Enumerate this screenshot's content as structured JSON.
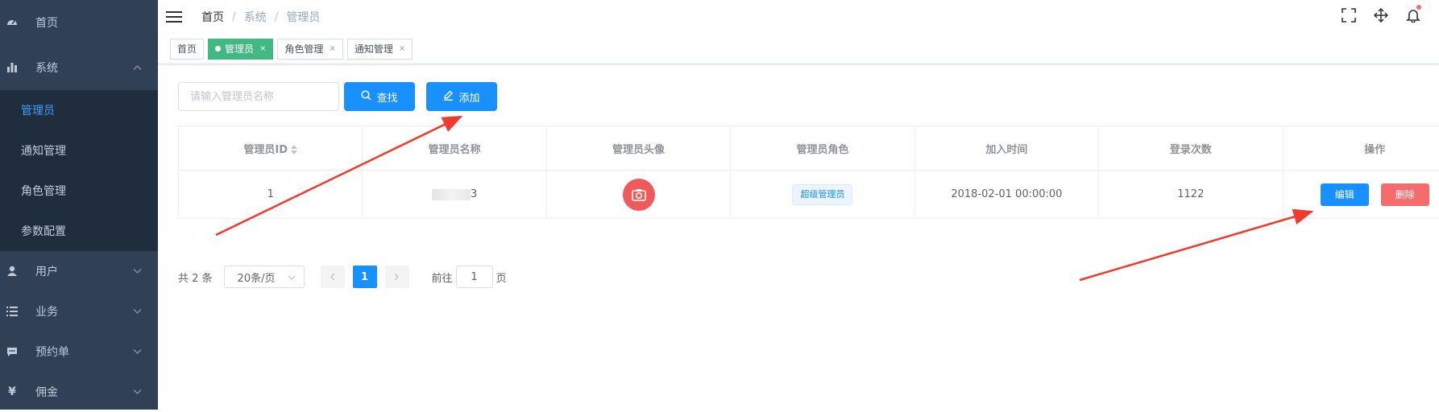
{
  "sidebar": {
    "items": [
      {
        "label": "首页",
        "icon": "dashboard-icon"
      },
      {
        "label": "系统",
        "icon": "bar-chart-icon",
        "expanded": true
      },
      {
        "label": "用户",
        "icon": "user-icon"
      },
      {
        "label": "业务",
        "icon": "list-icon"
      },
      {
        "label": "预约单",
        "icon": "message-icon"
      },
      {
        "label": "佣金",
        "icon": "yen-icon"
      }
    ],
    "subitems": [
      {
        "label": "管理员",
        "active": true
      },
      {
        "label": "通知管理"
      },
      {
        "label": "角色管理"
      },
      {
        "label": "参数配置"
      }
    ]
  },
  "breadcrumb": [
    "首页",
    "系统",
    "管理员"
  ],
  "tags": [
    {
      "label": "首页"
    },
    {
      "label": "管理员",
      "active": true
    },
    {
      "label": "角色管理"
    },
    {
      "label": "通知管理"
    }
  ],
  "tag_close": "×",
  "filter": {
    "placeholder": "请输入管理员名称",
    "search_label": "查找",
    "add_label": "添加"
  },
  "table": {
    "headers": [
      "管理员ID",
      "管理员名称",
      "管理员头像",
      "管理员角色",
      "加入时间",
      "登录次数",
      "操作"
    ],
    "rows": [
      {
        "id": "1",
        "name_suffix": "3",
        "role": "超级管理员",
        "joined": "2018-02-01 00:00:00",
        "logins": "1122"
      }
    ],
    "edit_label": "编辑",
    "delete_label": "删除"
  },
  "pagination": {
    "total": "共 2 条",
    "page_size": "20条/页",
    "current": "1",
    "goto_prefix": "前往",
    "goto_value": "1",
    "goto_suffix": "页"
  },
  "colors": {
    "sidebar_bg": "#304156",
    "primary": "#1890ff",
    "active_tag": "#42b983",
    "danger": "#f56c6c",
    "annotation_arrow": "#f03a2e"
  }
}
